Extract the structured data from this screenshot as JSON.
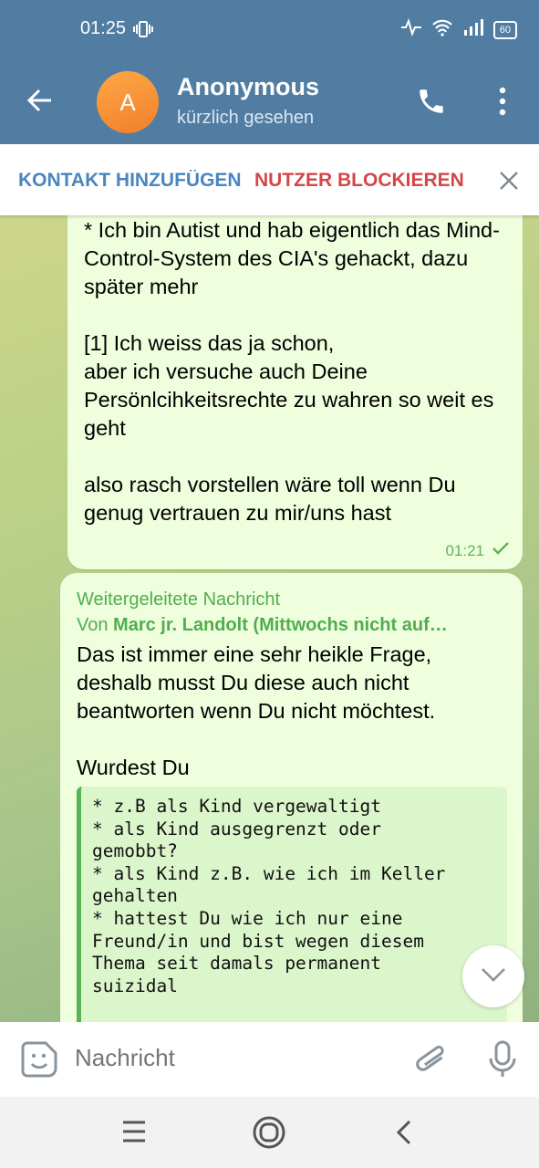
{
  "status_bar": {
    "time": "01:25",
    "battery": "60"
  },
  "header": {
    "avatar_letter": "A",
    "contact_name": "Anonymous",
    "last_seen": "kürzlich gesehen"
  },
  "action_bar": {
    "add_contact": "KONTAKT HINZUFÜGEN",
    "block_user": "NUTZER BLOCKIEREN"
  },
  "messages": [
    {
      "text": "ungemütlich\n* Ich bin Autist und hab eigentlich das Mind-Control-System des CIA's gehackt, dazu später mehr\n\n[1] Ich weiss das ja schon,\naber ich versuche auch Deine Persönlcihkeitsrechte zu wahren so weit es geht\n\nalso rasch vorstellen wäre toll wenn Du genug vertrauen zu mir/uns hast",
      "time": "01:21"
    },
    {
      "forward_label": "Weitergeleitete Nachricht",
      "forward_from_prefix": "Von ",
      "forward_from": "Marc jr. Landolt (Mittwochs nicht auf…",
      "text": "Das ist immer eine sehr heikle Frage, deshalb musst Du diese auch nicht beantworten wenn Du nicht möchtest.\n\nWurdest Du",
      "code": "* z.B als Kind vergewaltigt\n* als Kind ausgegrenzt oder\ngemobbt?\n* als Kind z.B. wie ich im Keller\ngehalten\n* hattest Du wie ich nur eine\nFreund/in und bist wegen diesem\nThema seit damals permanent\nsuizidal"
    }
  ],
  "input": {
    "placeholder": "Nachricht"
  },
  "colors": {
    "header": "#517da2",
    "bubble": "#effedd",
    "accent_green": "#4fae4e",
    "block_red": "#d2474a",
    "link_blue": "#4a85c0"
  }
}
